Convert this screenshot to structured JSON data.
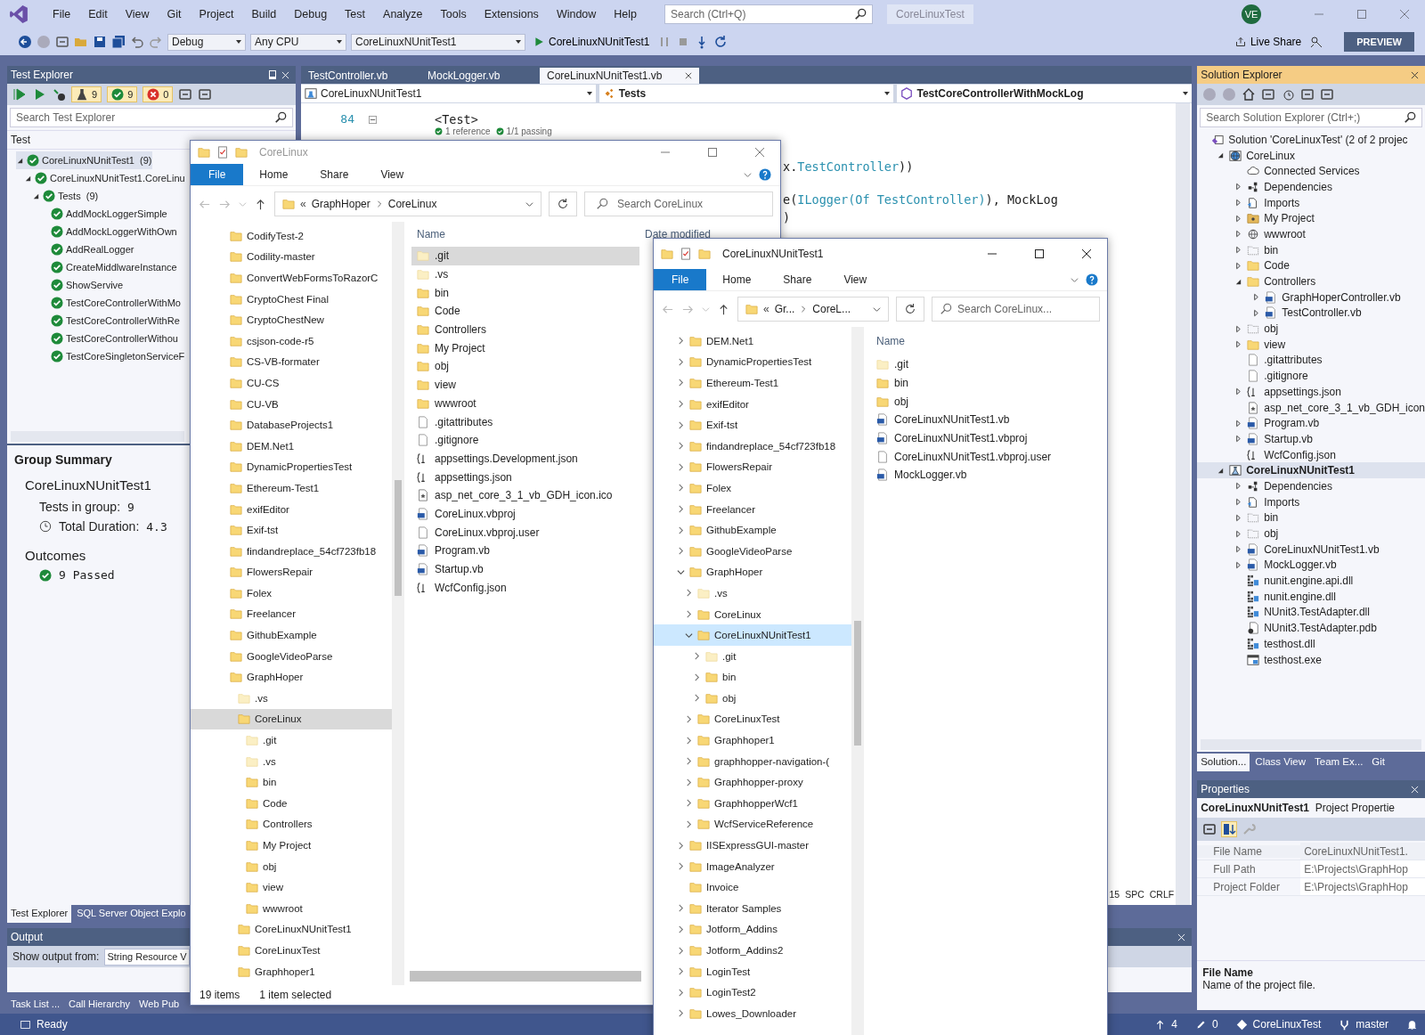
{
  "menu": [
    "File",
    "Edit",
    "View",
    "Git",
    "Project",
    "Build",
    "Debug",
    "Test",
    "Analyze",
    "Tools",
    "Extensions",
    "Window",
    "Help"
  ],
  "title_search": {
    "placeholder": "Search (Ctrl+Q)"
  },
  "solution_name": "CoreLinuxTest",
  "account_initials": "VE",
  "toolbar": {
    "configuration": "Debug",
    "platform": "Any CPU",
    "startup_project": "CoreLinuxNUnitTest1",
    "run_target": "CoreLinuxNUnitTest1",
    "live_share": "Live Share",
    "preview": "PREVIEW"
  },
  "test_explorer": {
    "title": "Test Explorer",
    "counters": [
      {
        "kind": "total",
        "count": "9"
      },
      {
        "kind": "passed",
        "count": "9"
      },
      {
        "kind": "failed",
        "count": "0"
      }
    ],
    "search": {
      "placeholder": "Search Test Explorer"
    },
    "column": "Test",
    "tree": [
      {
        "label": "CoreLinuxNUnitTest1",
        "count": "(9)",
        "passed": true,
        "expanded": true,
        "selected": true,
        "children": [
          {
            "label": "CoreLinuxNUnitTest1.CoreLinu",
            "passed": true,
            "expanded": true,
            "selected": false,
            "children": [
              {
                "label": "Tests",
                "count": "(9)",
                "passed": true,
                "expanded": true,
                "selected": false,
                "children": [
                  {
                    "label": "AddMockLoggerSimple",
                    "passed": true,
                    "selected": false
                  },
                  {
                    "label": "AddMockLoggerWithOwn",
                    "passed": true,
                    "selected": false
                  },
                  {
                    "label": "AddRealLogger",
                    "passed": true,
                    "selected": false
                  },
                  {
                    "label": "CreateMiddlwareInstance",
                    "passed": true,
                    "selected": false
                  },
                  {
                    "label": "ShowServive",
                    "passed": true,
                    "selected": false
                  },
                  {
                    "label": "TestCoreControllerWithMo",
                    "passed": true,
                    "selected": false
                  },
                  {
                    "label": "TestCoreControllerWithRe",
                    "passed": true,
                    "selected": false
                  },
                  {
                    "label": "TestCoreControllerWithou",
                    "passed": true,
                    "selected": false
                  },
                  {
                    "label": "TestCoreSingletonServiceF",
                    "passed": true,
                    "selected": false
                  }
                ]
              }
            ]
          }
        ]
      }
    ]
  },
  "group_summary": {
    "title": "Group Summary",
    "group": "CoreLinuxNUnitTest1",
    "tests_label": "Tests in group:",
    "tests_value": "9",
    "duration_label": "Total Duration:",
    "duration_value": "4.3",
    "outcomes_title": "Outcomes",
    "outcomes": [
      {
        "passed": true,
        "text": "9 Passed"
      }
    ]
  },
  "left_tabs": [
    {
      "label": "Test Explorer",
      "selected": true
    },
    {
      "label": "SQL Server Object Explo",
      "selected": false
    }
  ],
  "output": {
    "title": "Output",
    "show_from_label": "Show output from:",
    "source": "String Resource V"
  },
  "bottom_tabs": [
    {
      "label": "Task List ...",
      "selected": false
    },
    {
      "label": "Call Hierarchy",
      "selected": false
    },
    {
      "label": "Web Pub",
      "selected": false
    }
  ],
  "editor": {
    "tabs": [
      {
        "label": "TestController.vb",
        "selected": false
      },
      {
        "label": "MockLogger.vb",
        "selected": false
      },
      {
        "label": "CoreLinuxNUnitTest1.vb",
        "selected": true
      }
    ],
    "nav": [
      {
        "kind": "project",
        "text": "CoreLinuxNUnitTest1"
      },
      {
        "kind": "class",
        "text": "Tests"
      },
      {
        "kind": "member",
        "text": "TestCoreControllerWithMockLog"
      }
    ],
    "line_number": "84",
    "attribute_line": "<Test>",
    "codelens": [
      "1 reference",
      "1/1 passing"
    ],
    "code_fragments": [
      {
        "prefix": "x.",
        "type": "TestController",
        "suffix": "))"
      },
      {
        "prefix": "e(",
        "type": "ILogger(Of TestController)",
        "suffix": "), MockLog"
      },
      {
        "suffix": ")"
      }
    ],
    "status": [
      "15",
      "SPC",
      "CRLF"
    ]
  },
  "solution_explorer": {
    "title": "Solution Explorer",
    "search": {
      "placeholder": "Search Solution Explorer (Ctrl+;)"
    },
    "tree": [
      {
        "label": "Solution 'CoreLinuxTest' (2 of 2 projec",
        "kind": "solution",
        "selected": false,
        "children": [
          {
            "label": "CoreLinux",
            "kind": "webproject",
            "expanded": true,
            "selected": false,
            "children": [
              {
                "label": "Connected Services",
                "kind": "cloud",
                "selected": false
              },
              {
                "label": "Dependencies",
                "kind": "deps",
                "expanded": false,
                "selected": false
              },
              {
                "label": "Imports",
                "kind": "imports",
                "expanded": false,
                "selected": false
              },
              {
                "label": "My Project",
                "kind": "myproject",
                "expanded": false,
                "selected": false
              },
              {
                "label": "wwwroot",
                "kind": "globe",
                "expanded": false,
                "selected": false
              },
              {
                "label": "bin",
                "kind": "dotted",
                "expanded": false,
                "selected": false
              },
              {
                "label": "Code",
                "kind": "folder",
                "expanded": false,
                "selected": false
              },
              {
                "label": "Controllers",
                "kind": "folder",
                "expanded": true,
                "selected": false,
                "children": [
                  {
                    "label": "GraphHoperController.vb",
                    "kind": "vb",
                    "expanded": false,
                    "selected": false
                  },
                  {
                    "label": "TestController.vb",
                    "kind": "vb",
                    "expanded": false,
                    "selected": false
                  }
                ]
              },
              {
                "label": "obj",
                "kind": "dotted",
                "expanded": false,
                "selected": false
              },
              {
                "label": "view",
                "kind": "folder",
                "expanded": false,
                "selected": false
              },
              {
                "label": ".gitattributes",
                "kind": "file",
                "selected": false
              },
              {
                "label": ".gitignore",
                "kind": "file",
                "selected": false
              },
              {
                "label": "appsettings.json",
                "kind": "json",
                "expanded": false,
                "selected": false
              },
              {
                "label": "asp_net_core_3_1_vb_GDH_icon",
                "kind": "ico",
                "selected": false
              },
              {
                "label": "Program.vb",
                "kind": "vb",
                "expanded": false,
                "selected": false
              },
              {
                "label": "Startup.vb",
                "kind": "vb",
                "expanded": false,
                "selected": false
              },
              {
                "label": "WcfConfig.json",
                "kind": "json",
                "selected": false
              }
            ]
          },
          {
            "label": "CoreLinuxNUnitTest1",
            "kind": "testproject",
            "expanded": true,
            "selected": true,
            "children": [
              {
                "label": "Dependencies",
                "kind": "deps",
                "expanded": false,
                "selected": false
              },
              {
                "label": "Imports",
                "kind": "imports",
                "expanded": false,
                "selected": false
              },
              {
                "label": "bin",
                "kind": "dotted",
                "expanded": false,
                "selected": false
              },
              {
                "label": "obj",
                "kind": "dotted",
                "expanded": false,
                "selected": false
              },
              {
                "label": "CoreLinuxNUnitTest1.vb",
                "kind": "vb",
                "expanded": false,
                "selected": false
              },
              {
                "label": "MockLogger.vb",
                "kind": "vb",
                "expanded": false,
                "selected": false
              },
              {
                "label": "nunit.engine.api.dll",
                "kind": "dll",
                "selected": false
              },
              {
                "label": "nunit.engine.dll",
                "kind": "dll",
                "selected": false
              },
              {
                "label": "NUnit3.TestAdapter.dll",
                "kind": "dll",
                "selected": false
              },
              {
                "label": "NUnit3.TestAdapter.pdb",
                "kind": "pdb",
                "selected": false
              },
              {
                "label": "testhost.dll",
                "kind": "dll",
                "selected": false
              },
              {
                "label": "testhost.exe",
                "kind": "exe",
                "selected": false
              }
            ]
          }
        ]
      }
    ]
  },
  "right_tabs": [
    {
      "label": "Solution...",
      "selected": true
    },
    {
      "label": "Class View",
      "selected": false
    },
    {
      "label": "Team Ex...",
      "selected": false
    },
    {
      "label": "Git",
      "selected": false
    }
  ],
  "properties": {
    "title": "Properties",
    "object": "CoreLinuxNUnitTest1",
    "object_type": "Project Propertie",
    "rows": [
      {
        "name": "File Name",
        "value": "CoreLinuxNUnitTest1.",
        "selected": true
      },
      {
        "name": "Full Path",
        "value": "E:\\Projects\\GraphHop",
        "selected": false
      },
      {
        "name": "Project Folder",
        "value": "E:\\Projects\\GraphHop",
        "selected": false
      }
    ],
    "description_title": "File Name",
    "description": "Name of the project file."
  },
  "status_bar": {
    "text": "Ready",
    "commits": "4",
    "changes": "0",
    "repository": "CoreLinuxTest",
    "branch": "master"
  },
  "explorer_windows": [
    {
      "title": "CoreLinux",
      "ribbon_tabs": [
        {
          "label": "File",
          "selected": true
        },
        {
          "label": "Home",
          "selected": false
        },
        {
          "label": "Share",
          "selected": false
        },
        {
          "label": "View",
          "selected": false
        }
      ],
      "address_overflow": "«",
      "address": [
        "GraphHoper",
        "CoreLinux"
      ],
      "search": {
        "placeholder": "Search CoreLinux"
      },
      "nav": [
        {
          "label": "CodifyTest-2",
          "kind": "folder",
          "selected": false
        },
        {
          "label": "Codility-master",
          "kind": "folder",
          "selected": false
        },
        {
          "label": "ConvertWebFormsToRazorC",
          "kind": "folder",
          "selected": false
        },
        {
          "label": "CryptoChest Final",
          "kind": "folder",
          "selected": false
        },
        {
          "label": "CryptoChestNew",
          "kind": "folder",
          "selected": false
        },
        {
          "label": "csjson-code-r5",
          "kind": "folder",
          "selected": false
        },
        {
          "label": "CS-VB-formater",
          "kind": "folder",
          "selected": false
        },
        {
          "label": "CU-CS",
          "kind": "folder",
          "selected": false
        },
        {
          "label": "CU-VB",
          "kind": "folder",
          "selected": false
        },
        {
          "label": "DatabaseProjects1",
          "kind": "folder",
          "selected": false
        },
        {
          "label": "DEM.Net1",
          "kind": "folder",
          "selected": false
        },
        {
          "label": "DynamicPropertiesTest",
          "kind": "folder",
          "selected": false
        },
        {
          "label": "Ethereum-Test1",
          "kind": "folder",
          "selected": false
        },
        {
          "label": "exifEditor",
          "kind": "folder",
          "selected": false
        },
        {
          "label": "Exif-tst",
          "kind": "folder",
          "selected": false
        },
        {
          "label": "findandreplace_54cf723fb18",
          "kind": "folder",
          "selected": false
        },
        {
          "label": "FlowersRepair",
          "kind": "folder",
          "selected": false
        },
        {
          "label": "Folex",
          "kind": "folder",
          "selected": false
        },
        {
          "label": "Freelancer",
          "kind": "folder",
          "selected": false
        },
        {
          "label": "GithubExample",
          "kind": "folder",
          "selected": false
        },
        {
          "label": "GoogleVideoParse",
          "kind": "folder",
          "selected": false
        },
        {
          "label": "GraphHoper",
          "kind": "folder",
          "selected": false,
          "children": [
            {
              "label": ".vs",
              "kind": "pale",
              "selected": false
            },
            {
              "label": "CoreLinux",
              "kind": "folder",
              "selected": true,
              "children": [
                {
                  "label": ".git",
                  "kind": "pale",
                  "selected": false
                },
                {
                  "label": ".vs",
                  "kind": "pale",
                  "selected": false
                },
                {
                  "label": "bin",
                  "kind": "folder",
                  "selected": false
                },
                {
                  "label": "Code",
                  "kind": "folder",
                  "selected": false
                },
                {
                  "label": "Controllers",
                  "kind": "folder",
                  "selected": false
                },
                {
                  "label": "My Project",
                  "kind": "folder",
                  "selected": false
                },
                {
                  "label": "obj",
                  "kind": "folder",
                  "selected": false
                },
                {
                  "label": "view",
                  "kind": "folder",
                  "selected": false
                },
                {
                  "label": "wwwroot",
                  "kind": "folder",
                  "selected": false
                }
              ]
            },
            {
              "label": "CoreLinuxNUnitTest1",
              "kind": "folder",
              "selected": false
            },
            {
              "label": "CoreLinuxTest",
              "kind": "folder",
              "selected": false
            },
            {
              "label": "Graphhoper1",
              "kind": "folder",
              "selected": false
            }
          ]
        }
      ],
      "columns": [
        "Name",
        "Date modified"
      ],
      "files": [
        {
          "label": ".git",
          "kind": "pale",
          "selected": true
        },
        {
          "label": ".vs",
          "kind": "pale",
          "selected": false
        },
        {
          "label": "bin",
          "kind": "folder",
          "selected": false
        },
        {
          "label": "Code",
          "kind": "folder",
          "selected": false
        },
        {
          "label": "Controllers",
          "kind": "folder",
          "selected": false
        },
        {
          "label": "My Project",
          "kind": "folder",
          "selected": false
        },
        {
          "label": "obj",
          "kind": "folder",
          "selected": false
        },
        {
          "label": "view",
          "kind": "folder",
          "selected": false
        },
        {
          "label": "wwwroot",
          "kind": "folder",
          "selected": false
        },
        {
          "label": ".gitattributes",
          "kind": "file",
          "selected": false
        },
        {
          "label": ".gitignore",
          "kind": "file",
          "selected": false
        },
        {
          "label": "appsettings.Development.json",
          "kind": "json",
          "selected": false
        },
        {
          "label": "appsettings.json",
          "kind": "json",
          "selected": false
        },
        {
          "label": "asp_net_core_3_1_vb_GDH_icon.ico",
          "kind": "ico",
          "selected": false
        },
        {
          "label": "CoreLinux.vbproj",
          "kind": "vb",
          "selected": false
        },
        {
          "label": "CoreLinux.vbproj.user",
          "kind": "user",
          "selected": false
        },
        {
          "label": "Program.vb",
          "kind": "vb",
          "selected": false
        },
        {
          "label": "Startup.vb",
          "kind": "vb",
          "selected": false
        },
        {
          "label": "WcfConfig.json",
          "kind": "json",
          "selected": false
        }
      ],
      "status": [
        "19 items",
        "1 item selected"
      ]
    },
    {
      "title": "CoreLinuxNUnitTest1",
      "ribbon_tabs": [
        {
          "label": "File",
          "selected": true
        },
        {
          "label": "Home",
          "selected": false
        },
        {
          "label": "Share",
          "selected": false
        },
        {
          "label": "View",
          "selected": false
        }
      ],
      "address_overflow": "«",
      "address": [
        "Gr...",
        "CoreL..."
      ],
      "search": {
        "placeholder": "Search CoreLinux..."
      },
      "nav": [
        {
          "label": "DEM.Net1",
          "kind": "folder",
          "expanded": false,
          "selected": false
        },
        {
          "label": "DynamicPropertiesTest",
          "kind": "folder",
          "expanded": false,
          "selected": false
        },
        {
          "label": "Ethereum-Test1",
          "kind": "folder",
          "expanded": false,
          "selected": false
        },
        {
          "label": "exifEditor",
          "kind": "folder",
          "expanded": false,
          "selected": false
        },
        {
          "label": "Exif-tst",
          "kind": "folder",
          "expanded": false,
          "selected": false
        },
        {
          "label": "findandreplace_54cf723fb18",
          "kind": "folder",
          "expanded": false,
          "selected": false
        },
        {
          "label": "FlowersRepair",
          "kind": "folder",
          "expanded": false,
          "selected": false
        },
        {
          "label": "Folex",
          "kind": "folder",
          "expanded": false,
          "selected": false
        },
        {
          "label": "Freelancer",
          "kind": "folder",
          "expanded": false,
          "selected": false
        },
        {
          "label": "GithubExample",
          "kind": "folder",
          "expanded": false,
          "selected": false
        },
        {
          "label": "GoogleVideoParse",
          "kind": "folder",
          "expanded": false,
          "selected": false
        },
        {
          "label": "GraphHoper",
          "kind": "folder",
          "expanded": true,
          "selected": false,
          "children": [
            {
              "label": ".vs",
              "kind": "pale",
              "expanded": false,
              "selected": false
            },
            {
              "label": "CoreLinux",
              "kind": "folder",
              "expanded": false,
              "selected": false
            },
            {
              "label": "CoreLinuxNUnitTest1",
              "kind": "folder",
              "expanded": true,
              "selected": true,
              "children": [
                {
                  "label": ".git",
                  "kind": "pale",
                  "expanded": false,
                  "selected": false
                },
                {
                  "label": "bin",
                  "kind": "folder",
                  "expanded": false,
                  "selected": false
                },
                {
                  "label": "obj",
                  "kind": "folder",
                  "expanded": false,
                  "selected": false
                }
              ]
            },
            {
              "label": "CoreLinuxTest",
              "kind": "folder",
              "expanded": false,
              "selected": false
            },
            {
              "label": "Graphhoper1",
              "kind": "folder",
              "expanded": false,
              "selected": false
            },
            {
              "label": "graphhopper-navigation-(",
              "kind": "folder",
              "expanded": false,
              "selected": false
            },
            {
              "label": "Graphhopper-proxy",
              "kind": "folder",
              "expanded": false,
              "selected": false
            },
            {
              "label": "GraphhopperWcf1",
              "kind": "folder",
              "expanded": false,
              "selected": false
            },
            {
              "label": "WcfServiceReference",
              "kind": "folder",
              "expanded": false,
              "selected": false
            }
          ]
        },
        {
          "label": "IISExpressGUI-master",
          "kind": "folder",
          "expanded": false,
          "selected": false
        },
        {
          "label": "ImageAnalyzer",
          "kind": "folder",
          "expanded": false,
          "selected": false
        },
        {
          "label": "Invoice",
          "kind": "folder",
          "selected": false
        },
        {
          "label": "Iterator Samples",
          "kind": "folder",
          "expanded": false,
          "selected": false
        },
        {
          "label": "Jotform_Addins",
          "kind": "folder",
          "expanded": false,
          "selected": false
        },
        {
          "label": "Jotform_Addins2",
          "kind": "folder",
          "expanded": false,
          "selected": false
        },
        {
          "label": "LoginTest",
          "kind": "folder",
          "expanded": false,
          "selected": false
        },
        {
          "label": "LoginTest2",
          "kind": "folder",
          "expanded": false,
          "selected": false
        },
        {
          "label": "Lowes_Downloader",
          "kind": "folder",
          "expanded": false,
          "selected": false
        }
      ],
      "columns": [
        "Name"
      ],
      "files": [
        {
          "label": ".git",
          "kind": "pale",
          "selected": false
        },
        {
          "label": "bin",
          "kind": "folder",
          "selected": false
        },
        {
          "label": "obj",
          "kind": "folder",
          "selected": false
        },
        {
          "label": "CoreLinuxNUnitTest1.vb",
          "kind": "vb",
          "selected": false
        },
        {
          "label": "CoreLinuxNUnitTest1.vbproj",
          "kind": "vb",
          "selected": false
        },
        {
          "label": "CoreLinuxNUnitTest1.vbproj.user",
          "kind": "user",
          "selected": false
        },
        {
          "label": "MockLogger.vb",
          "kind": "vb",
          "selected": false
        }
      ]
    }
  ]
}
